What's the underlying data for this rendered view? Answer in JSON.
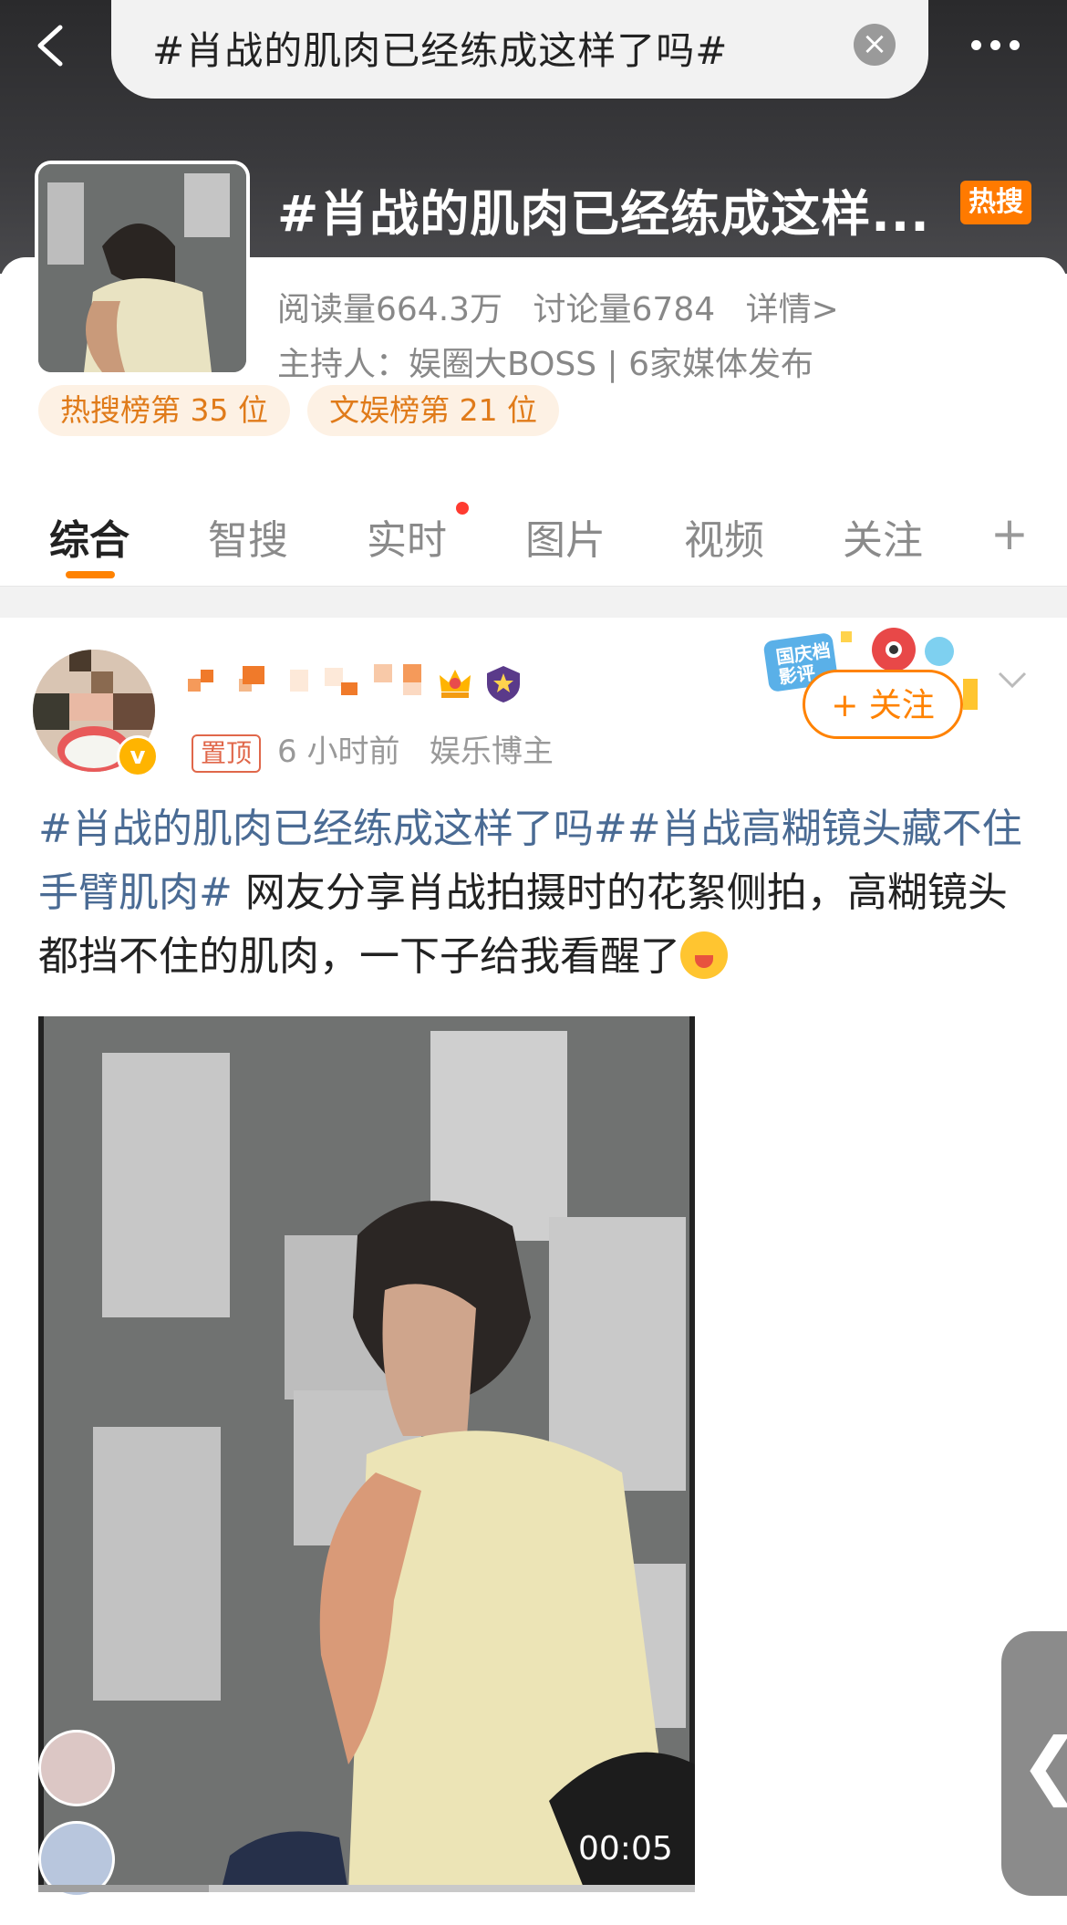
{
  "search": {
    "query": "#肖战的肌肉已经练成这样了吗#",
    "clear_label": "×"
  },
  "topic": {
    "title": "#肖战的肌肉已经练成这样...",
    "hot_badge": "热搜",
    "reads": "阅读量664.3万",
    "discussions": "讨论量6784",
    "details": "详情>",
    "host": "主持人：娱圈大BOSS | 6家媒体发布",
    "ranks": [
      "热搜榜第 35 位",
      "文娱榜第 21 位"
    ]
  },
  "tabs": [
    "综合",
    "智搜",
    "实时",
    "图片",
    "视频",
    "关注"
  ],
  "tab_plus": "+",
  "post": {
    "pin": "置顶",
    "time": "6 小时前",
    "role": "娱乐博主",
    "follow": "+ 关注",
    "hashtag1": "#肖战的肌肉已经练成这样了吗#",
    "hashtag2": "#肖战高糊镜头藏不住手臂肌肉#",
    "body": " 网友分享肖战拍摄时的花絮侧拍，高糊镜头都挡不住的肌肉，一下子给我看醒了",
    "video_time": "00:05",
    "video_progress": 0.26
  },
  "colors": {
    "accent": "#ff8200",
    "hashtag": "#4a6b94",
    "hot": "#ff7a00"
  },
  "icons": [
    "back-arrow-icon",
    "clear-icon",
    "more-icon",
    "crown-icon",
    "shield-icon",
    "chevron-down-icon",
    "emoji-icon"
  ]
}
